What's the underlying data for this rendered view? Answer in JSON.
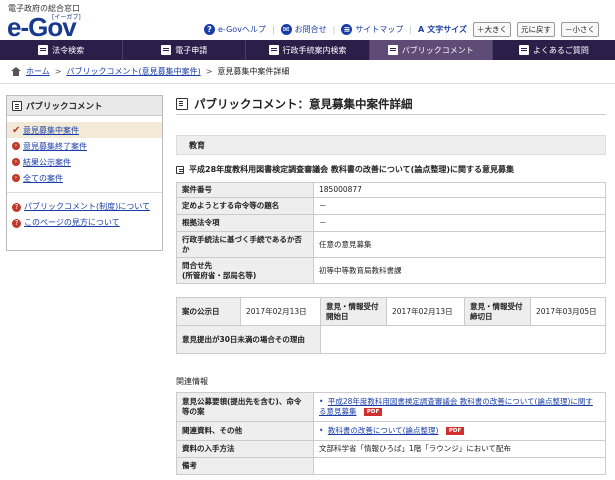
{
  "header": {
    "tagline": "電子政府の総合窓口",
    "logo_text": "e-Gov",
    "logo_reading": "[イーガブ]",
    "links": [
      {
        "label": "e-Govヘルプ",
        "icon": "help-icon"
      },
      {
        "label": "お問合せ",
        "icon": "mail-icon"
      },
      {
        "label": "サイトマップ",
        "icon": "sitemap-icon"
      }
    ],
    "text_size_label": "文字サイズ",
    "text_size_buttons": [
      "＋大きく",
      "元に戻す",
      "－小さく"
    ]
  },
  "nav": {
    "items": [
      {
        "label": "法令検索",
        "active": false
      },
      {
        "label": "電子申請",
        "active": false
      },
      {
        "label": "行政手続案内検索",
        "active": false
      },
      {
        "label": "パブリックコメント",
        "active": true
      },
      {
        "label": "よくあるご質問",
        "active": false
      }
    ]
  },
  "breadcrumb": {
    "items": [
      "ホーム",
      "パブリックコメント(意見募集中案件)",
      "意見募集中案件詳細"
    ]
  },
  "sidebar": {
    "title": "パブリックコメント",
    "items": [
      {
        "label": "意見募集中案件",
        "current": true
      },
      {
        "label": "意見募集終了案件",
        "current": false
      },
      {
        "label": "結果公示案件",
        "current": false
      },
      {
        "label": "全ての案件",
        "current": false
      }
    ],
    "help_links": [
      {
        "label": "パブリックコメント(制度)について"
      },
      {
        "label": "このページの見方について"
      }
    ]
  },
  "main": {
    "title": "パブリックコメント：意見募集中案件詳細",
    "category": "教育",
    "case_title": "平成28年度教科用図書検定調査審議会 教科書の改善について(論点整理)に関する意見募集",
    "details": [
      {
        "label": "案件番号",
        "value": "185000877"
      },
      {
        "label": "定めようとする命令等の題名",
        "value": "－"
      },
      {
        "label": "根拠法令項",
        "value": "－"
      },
      {
        "label": "行政手続法に基づく手続であるか否か",
        "value": "任意の意見募集"
      },
      {
        "label": "問合せ先\n(所管府省・部局名等)",
        "value": "初等中等教育局教科書課"
      }
    ],
    "dates": {
      "publish_label": "案の公示日",
      "publish_value": "2017年02月13日",
      "start_label": "意見・情報受付開始日",
      "start_value": "2017年02月13日",
      "end_label": "意見・情報受付締切日",
      "end_value": "2017年03月05日",
      "reason_label": "意見提出が30日未満の場合その理由",
      "reason_value": ""
    },
    "related_label": "関連情報",
    "related": {
      "outline_label": "意見公募要領(提出先を含む)、命令等の案",
      "outline_link": "平成28年度教科用図書検定調査審議会 教科書の改善について(論点整理)に関する意見募集",
      "other_label": "関連資料、その他",
      "other_link": "教科書の改善について(論点整理)",
      "pdf_badge": "PDF",
      "obtain_label": "資料の入手方法",
      "obtain_value": "文部科学省「情報ひろば」1階「ラウンジ」において配布",
      "remarks_label": "備考",
      "remarks_value": ""
    }
  }
}
